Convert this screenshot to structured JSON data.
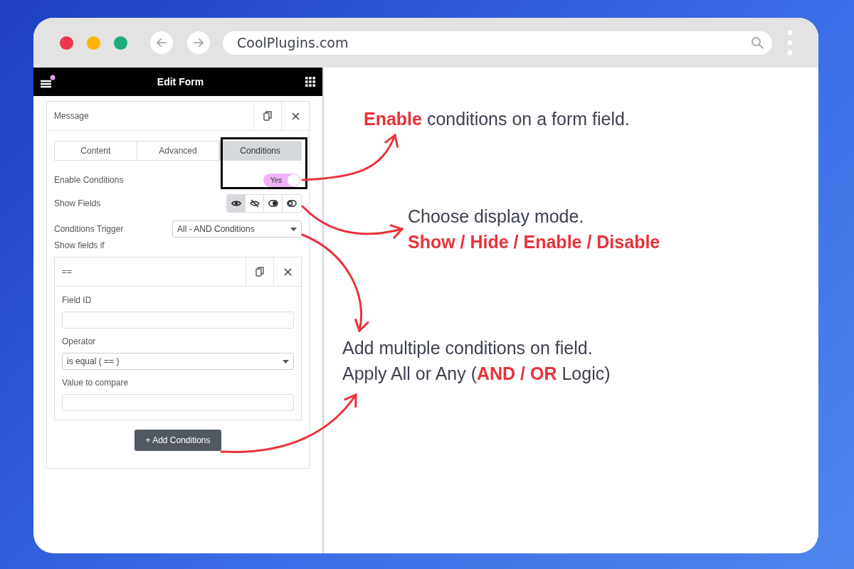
{
  "browser": {
    "url": "CoolPlugins.com"
  },
  "panel": {
    "title": "Edit Form"
  },
  "field_card": {
    "title": "Message",
    "tabs": [
      {
        "label": "Content",
        "selected": false
      },
      {
        "label": "Advanced",
        "selected": false
      },
      {
        "label": "Conditions",
        "selected": true
      }
    ],
    "enable_conditions": {
      "label": "Enable Conditions",
      "on": true,
      "toggle_label": "Yes"
    },
    "show_fields": {
      "label": "Show Fields",
      "modes": [
        {
          "kind": "show",
          "selected": true
        },
        {
          "kind": "hide",
          "selected": false
        },
        {
          "kind": "enable",
          "selected": false
        },
        {
          "kind": "disable",
          "selected": false
        }
      ]
    },
    "conditions_trigger": {
      "label": "Conditions Trigger",
      "value": "All - AND Conditions"
    },
    "show_fields_if": {
      "label": "Show fields if",
      "condition": {
        "title": "==",
        "field_id": {
          "label": "Field ID"
        },
        "operator": {
          "label": "Operator",
          "value": "is equal ( == )"
        },
        "value_to_compare": {
          "label": "Value to compare"
        }
      }
    },
    "add_button": "+ Add Conditions"
  },
  "annotations": [
    {
      "text": "**Enable** conditions on a form field."
    },
    {
      "text": "Choose display mode.",
      "highlight": "Show / Hide / Enable / Disable"
    },
    {
      "text": "Add multiple conditions on field.",
      "text_2": "Apply All or Any (**AND / OR** Logic)"
    }
  ]
}
